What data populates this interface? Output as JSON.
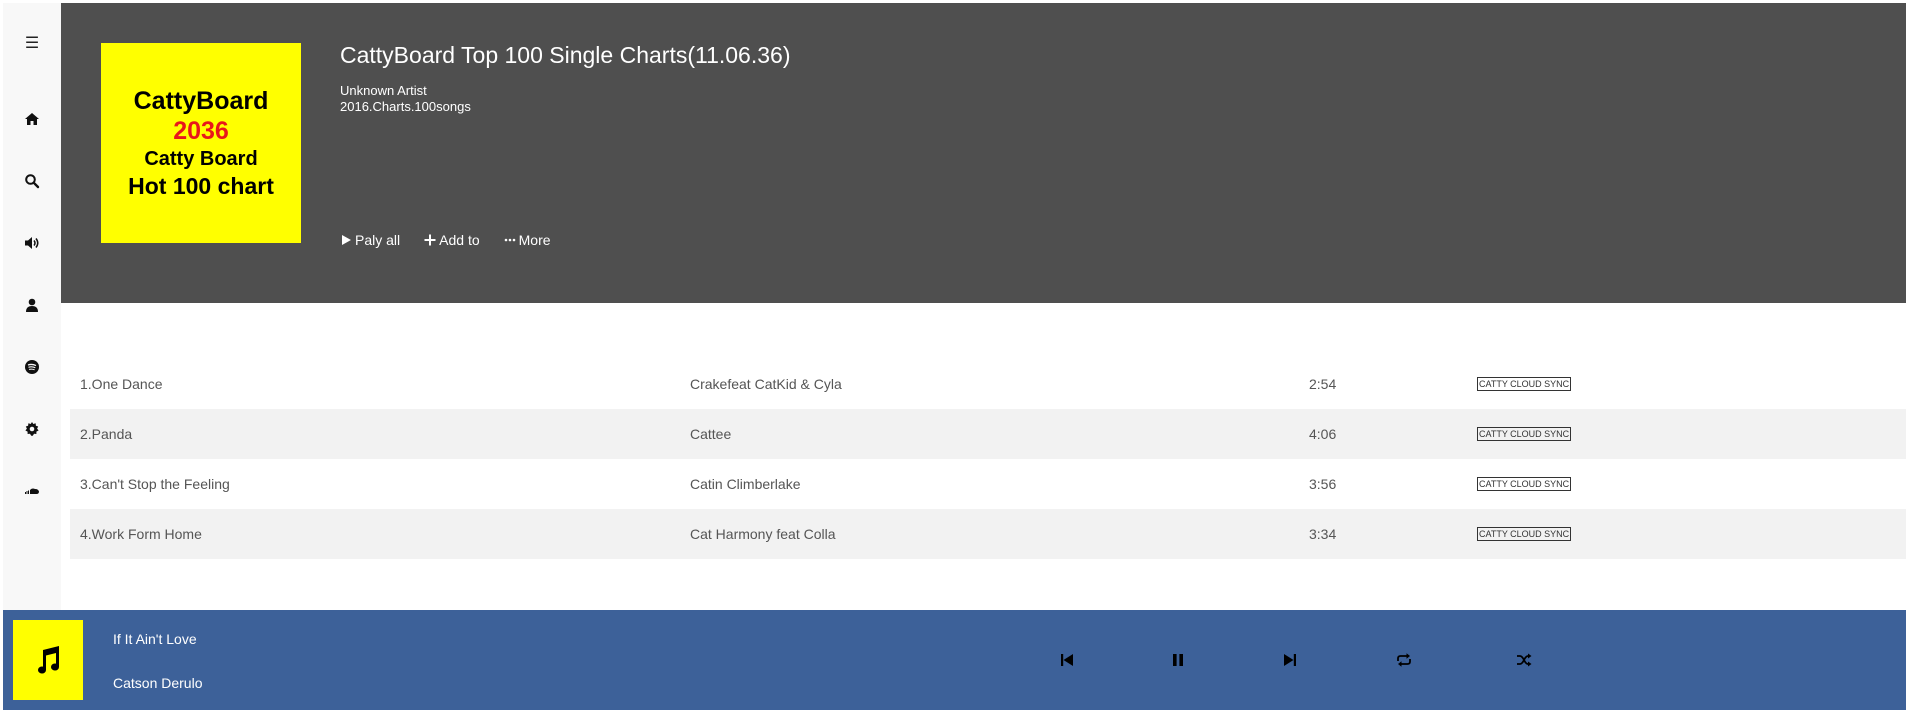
{
  "sidebar": {
    "items": [
      {
        "icon": "menu-icon",
        "glyph": "☰"
      },
      {
        "icon": "home-icon"
      },
      {
        "icon": "search-icon"
      },
      {
        "icon": "volume-icon"
      },
      {
        "icon": "user-icon"
      },
      {
        "icon": "spotify-icon"
      },
      {
        "icon": "gear-icon"
      },
      {
        "icon": "soundcloud-icon"
      }
    ]
  },
  "album": {
    "cover": {
      "line1": "CattyBoard",
      "line2": "2036",
      "line3": "Catty Board",
      "line4": "Hot 100 chart"
    },
    "title": "CattyBoard Top 100 Single Charts(11.06.36)",
    "artist": "Unknown Artist",
    "description": "2016.Charts.100songs",
    "actions": {
      "play_all": "Paly all",
      "add_to": "Add to",
      "more": "More"
    }
  },
  "tracks": [
    {
      "title": "1.One Dance",
      "artist": "Crakefeat CatKid & Cyla",
      "duration": "2:54",
      "badge": "CATTY CLOUD SYNC"
    },
    {
      "title": "2.Panda",
      "artist": "Cattee",
      "duration": "4:06",
      "badge": "CATTY CLOUD SYNC"
    },
    {
      "title": "3.Can't Stop the Feeling",
      "artist": "Catin Climberlake",
      "duration": "3:56",
      "badge": "CATTY CLOUD SYNC"
    },
    {
      "title": "4.Work Form Home",
      "artist": "Cat Harmony feat Colla",
      "duration": "3:34",
      "badge": "CATTY CLOUD SYNC"
    }
  ],
  "player": {
    "song": "If It Ain't Love",
    "artist": "Catson Derulo",
    "controls": [
      "previous",
      "pause",
      "next",
      "repeat",
      "shuffle"
    ]
  },
  "colors": {
    "header_bg": "#4f4f4f",
    "player_bg": "#3d6199",
    "cover_bg": "#ffff00",
    "accent_red": "#e8171b",
    "sidebar_bg": "#f8f8f8"
  }
}
